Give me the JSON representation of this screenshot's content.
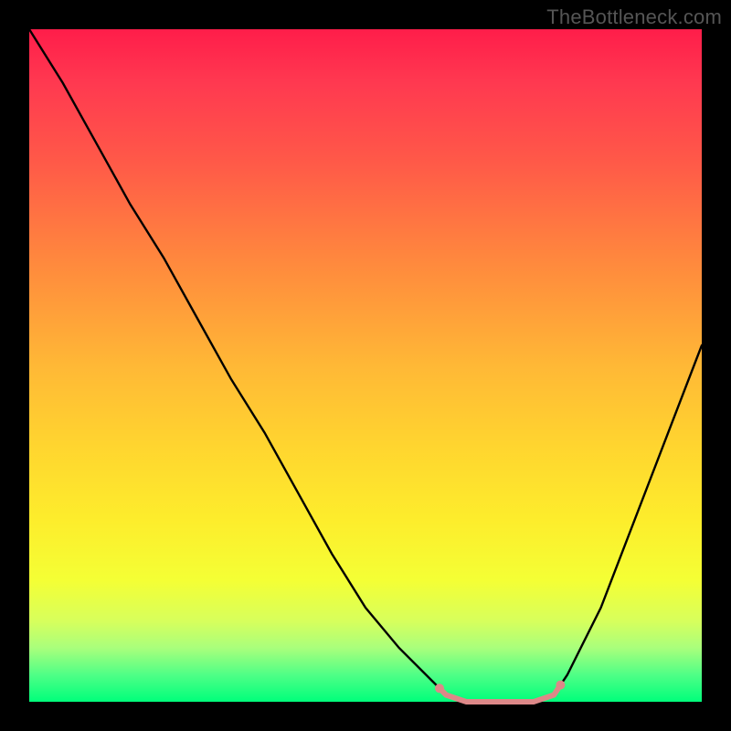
{
  "watermark": "TheBottleneck.com",
  "colors": {
    "frame": "#000000",
    "gradient_top": "#ff1d4a",
    "gradient_bottom": "#00ff7b",
    "curve": "#000000",
    "highlight": "#e08080"
  },
  "chart_data": {
    "type": "line",
    "title": "",
    "xlabel": "",
    "ylabel": "",
    "xlim": [
      0,
      100
    ],
    "ylim": [
      0,
      100
    ],
    "series": [
      {
        "name": "curve",
        "x": [
          0,
          5,
          10,
          15,
          20,
          25,
          30,
          35,
          40,
          45,
          50,
          55,
          60,
          62,
          65,
          70,
          75,
          78,
          80,
          85,
          90,
          95,
          100
        ],
        "y": [
          100,
          92,
          83,
          74,
          66,
          57,
          48,
          40,
          31,
          22,
          14,
          8,
          3,
          1,
          0,
          0,
          0,
          1,
          4,
          14,
          27,
          40,
          53
        ]
      }
    ],
    "highlight_range_x": [
      61,
      79
    ],
    "grid": false,
    "legend": null
  }
}
